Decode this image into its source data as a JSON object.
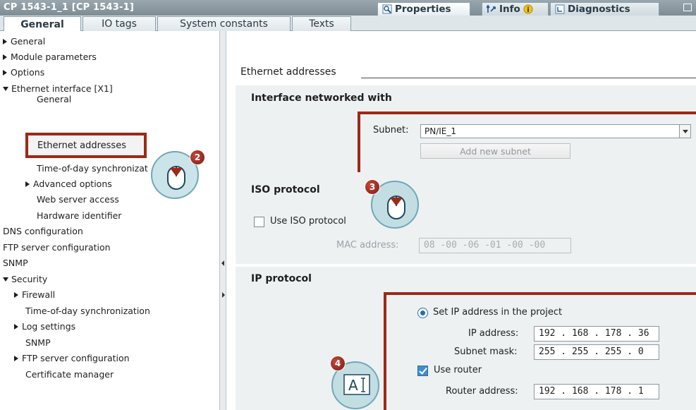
{
  "window": {
    "title": "CP 1543-1_1 [CP 1543-1]",
    "tabs": [
      {
        "label": "Properties",
        "active": true
      },
      {
        "label": "Info",
        "active": false
      },
      {
        "label": "Diagnostics",
        "active": false
      }
    ]
  },
  "subtabs": [
    {
      "label": "General",
      "active": true
    },
    {
      "label": "IO tags",
      "active": false
    },
    {
      "label": "System constants",
      "active": false
    },
    {
      "label": "Texts",
      "active": false
    }
  ],
  "tree": [
    {
      "label": "General",
      "state": "collapsed"
    },
    {
      "label": "Module parameters",
      "state": "collapsed"
    },
    {
      "label": "Options",
      "state": "collapsed"
    },
    {
      "label": "Ethernet interface [X1]",
      "state": "expanded"
    },
    {
      "label": "General",
      "state": "leaf"
    },
    {
      "label": "Ethernet addresses",
      "state": "leaf-selected"
    },
    {
      "label": "Time-of-day synchronizat",
      "state": "leaf"
    },
    {
      "label": "Advanced options",
      "state": "collapsed"
    },
    {
      "label": "Web server access",
      "state": "leaf"
    },
    {
      "label": "Hardware identifier",
      "state": "leaf"
    },
    {
      "label": "DNS configuration",
      "state": "leaf"
    },
    {
      "label": "FTP server configuration",
      "state": "leaf"
    },
    {
      "label": "SNMP",
      "state": "leaf"
    },
    {
      "label": "Security",
      "state": "expanded"
    },
    {
      "label": "Firewall",
      "state": "collapsed"
    },
    {
      "label": "Time-of-day synchronization",
      "state": "leaf"
    },
    {
      "label": "Log settings",
      "state": "collapsed"
    },
    {
      "label": "SNMP",
      "state": "leaf"
    },
    {
      "label": "FTP server configuration",
      "state": "collapsed"
    },
    {
      "label": "Certificate manager",
      "state": "leaf"
    }
  ],
  "content": {
    "heading": "Ethernet addresses",
    "interface": {
      "title": "Interface networked with",
      "subnet_label": "Subnet:",
      "subnet_value": "PN/IE_1",
      "add_subnet": "Add new subnet"
    },
    "iso": {
      "title": "ISO protocol",
      "use_iso_label": "Use ISO protocol",
      "use_iso_checked": false,
      "mac_label": "MAC address:",
      "mac_value": "08 -00 -06 -01 -00 -00"
    },
    "ip": {
      "title": "IP protocol",
      "set_ip_label": "Set IP address in the project",
      "ip_label": "IP address:",
      "ip_value": "192 . 168 . 178 . 36",
      "mask_label": "Subnet mask:",
      "mask_value": "255 . 255 . 255 . 0",
      "use_router_label": "Use router",
      "use_router_checked": true,
      "router_label": "Router address:",
      "router_value": "192 . 168 . 178 . 1"
    }
  },
  "callouts": [
    "2",
    "3",
    "4"
  ],
  "colors": {
    "callout": "#9b2a16",
    "selection": "#d6e4ee",
    "accent": "#2a6ea8"
  }
}
